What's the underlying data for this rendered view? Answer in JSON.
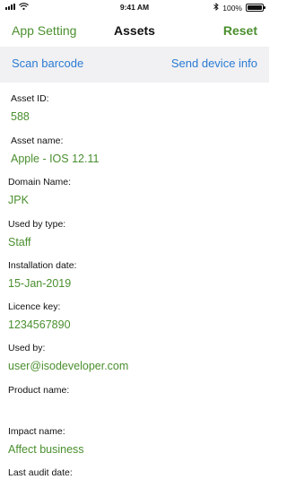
{
  "status_bar": {
    "time": "9:41 AM",
    "battery": "100%",
    "battery_level": 1.0
  },
  "nav": {
    "left_label": "App Setting",
    "title": "Assets",
    "right_label": "Reset"
  },
  "actions": {
    "scan_label": "Scan barcode",
    "send_label": "Send device info"
  },
  "fields": [
    {
      "label": "Asset ID:",
      "value": "588"
    },
    {
      "label": "Asset name:",
      "value": "Apple - IOS 12.11"
    },
    {
      "label": "Domain Name:",
      "value": "JPK"
    },
    {
      "label": "Used by type:",
      "value": "Staff"
    },
    {
      "label": "Installation date:",
      "value": "15-Jan-2019"
    },
    {
      "label": "Licence key:",
      "value": "1234567890"
    },
    {
      "label": "Used by:",
      "value": "user@isodeveloper.com"
    },
    {
      "label": "Product name:",
      "value": ""
    },
    {
      "label": "Impact name:",
      "value": "Affect business"
    },
    {
      "label": "Last audit date:",
      "value": ""
    }
  ],
  "colors": {
    "accent_green": "#4a8f2e",
    "accent_blue": "#2a7bd3",
    "action_bar_bg": "#f1f1f3"
  },
  "icons": {
    "signal": "cellular-signal-icon",
    "wifi": "wifi-icon",
    "bluetooth": "bluetooth-icon",
    "battery": "battery-icon"
  }
}
